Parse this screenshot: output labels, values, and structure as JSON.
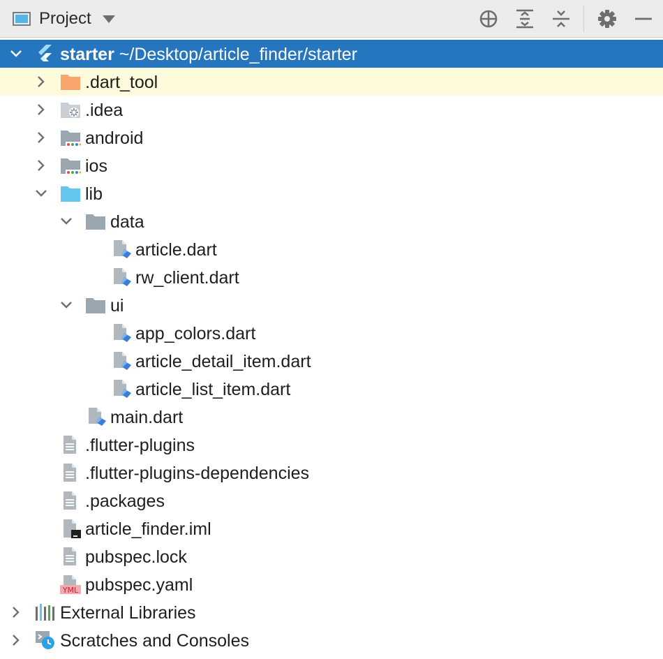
{
  "header": {
    "title": "Project",
    "toolbar_buttons": [
      "locate-icon",
      "expand-all-icon",
      "collapse-all-icon",
      "gear-icon",
      "minimize-icon"
    ]
  },
  "tree": {
    "root": {
      "name": "starter",
      "path": "~/Desktop/article_finder/starter",
      "icon": "flutter-icon"
    },
    "items": [
      {
        "label": ".dart_tool",
        "icon": "folder-orange-icon",
        "expanded": false
      },
      {
        "label": ".idea",
        "icon": "idea-folder-icon",
        "expanded": false
      },
      {
        "label": "android",
        "icon": "module-folder-icon",
        "expanded": false
      },
      {
        "label": "ios",
        "icon": "module-folder-icon",
        "expanded": false
      },
      {
        "label": "lib",
        "icon": "source-folder-icon",
        "expanded": true
      },
      {
        "label": "data",
        "icon": "folder-icon",
        "expanded": true
      },
      {
        "label": "article.dart",
        "icon": "dart-file-icon"
      },
      {
        "label": "rw_client.dart",
        "icon": "dart-file-icon"
      },
      {
        "label": "ui",
        "icon": "folder-icon",
        "expanded": true
      },
      {
        "label": "app_colors.dart",
        "icon": "dart-file-icon"
      },
      {
        "label": "article_detail_item.dart",
        "icon": "dart-file-icon"
      },
      {
        "label": "article_list_item.dart",
        "icon": "dart-file-icon"
      },
      {
        "label": "main.dart",
        "icon": "dart-file-icon"
      },
      {
        "label": ".flutter-plugins",
        "icon": "text-file-icon"
      },
      {
        "label": ".flutter-plugins-dependencies",
        "icon": "text-file-icon"
      },
      {
        "label": ".packages",
        "icon": "text-file-icon"
      },
      {
        "label": "article_finder.iml",
        "icon": "iml-file-icon"
      },
      {
        "label": "pubspec.lock",
        "icon": "text-file-icon"
      },
      {
        "label": "pubspec.yaml",
        "icon": "yaml-file-icon"
      },
      {
        "label": "External Libraries",
        "icon": "libraries-icon",
        "expanded": false
      },
      {
        "label": "Scratches and Consoles",
        "icon": "scratches-icon",
        "expanded": false
      }
    ]
  },
  "colors": {
    "selection": "#2675bf",
    "highlight_row": "#fdfbdc",
    "folder": "#9aa7b0",
    "source_folder": "#62c6ee",
    "orange_folder": "#f9a66c",
    "dart_blue": "#3a7fd5"
  }
}
